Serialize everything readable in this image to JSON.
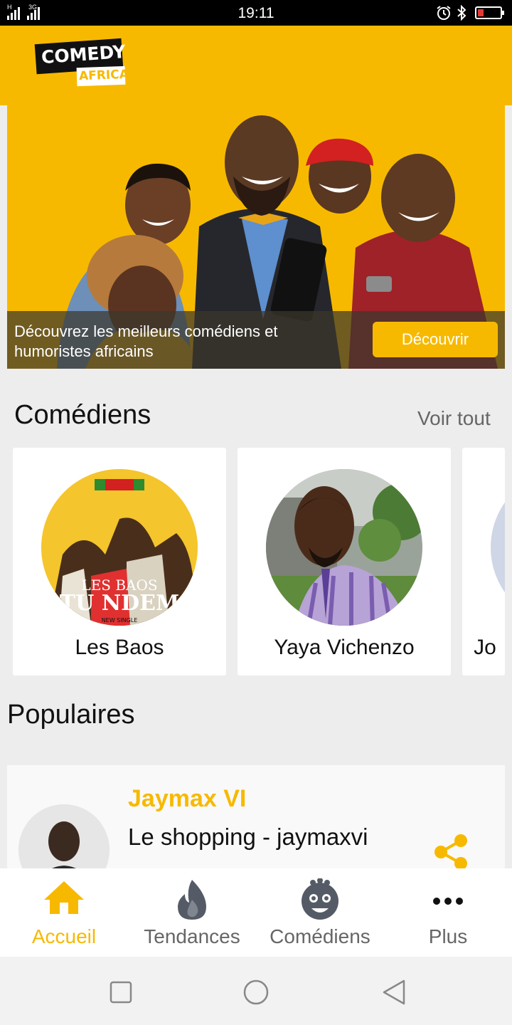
{
  "status_bar": {
    "time": "19:11",
    "network_1": "H",
    "network_2": "3G",
    "battery_level": 0.25,
    "battery_color": "#e53935"
  },
  "header": {
    "logo_line1": "COMEDY",
    "logo_line2": "AFRICA",
    "brand_color": "#f7b900"
  },
  "hero": {
    "caption": "Découvrez les meilleurs comédiens et humoristes africains",
    "button_label": "Découvrir"
  },
  "comediens": {
    "title": "Comédiens",
    "see_all": "Voir tout",
    "cards": [
      {
        "name": "Les Baos",
        "poster_line1": "LES BAOS",
        "poster_line2": "TU NDEM",
        "poster_line3": "NEW SINGLE"
      },
      {
        "name": "Yaya Vichenzo"
      },
      {
        "name": "Jo"
      }
    ]
  },
  "populaires": {
    "title": "Populaires",
    "items": [
      {
        "author": "Jaymax VI",
        "title": "Le shopping - jaymaxvi"
      }
    ]
  },
  "bottom_nav": {
    "items": [
      {
        "label": "Accueil",
        "icon": "home-icon",
        "active": true
      },
      {
        "label": "Tendances",
        "icon": "flame-icon",
        "active": false
      },
      {
        "label": "Comédiens",
        "icon": "comedian-face-icon",
        "active": false
      },
      {
        "label": "Plus",
        "icon": "more-dots-icon",
        "active": false
      }
    ]
  },
  "system_nav": {
    "buttons": [
      "recents-icon",
      "home-circle-icon",
      "back-icon"
    ]
  }
}
